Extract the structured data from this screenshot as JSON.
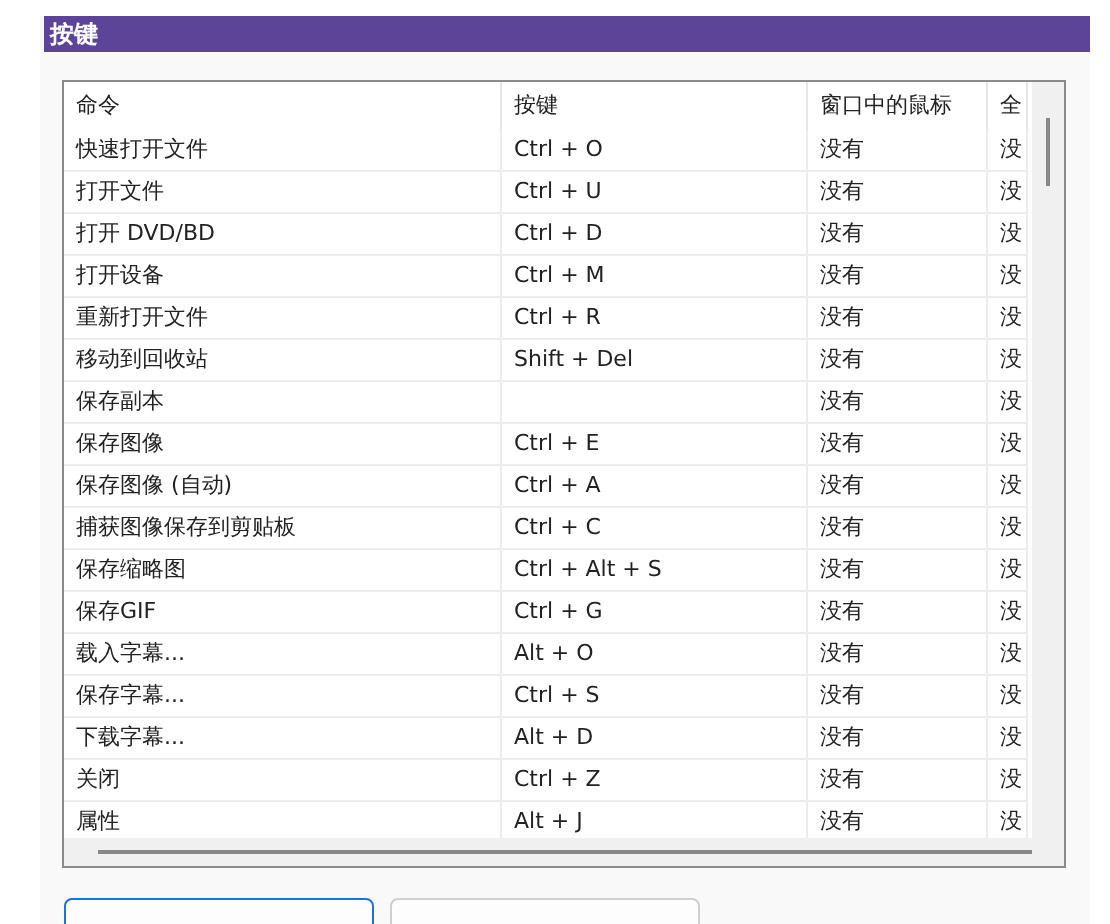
{
  "section": {
    "title": "按键"
  },
  "table": {
    "columns": [
      "命令",
      "按键",
      "窗口中的鼠标",
      "全"
    ],
    "rows": [
      [
        "快速打开文件",
        "Ctrl + O",
        "没有",
        "没"
      ],
      [
        "打开文件",
        "Ctrl + U",
        "没有",
        "没"
      ],
      [
        "打开 DVD/BD",
        "Ctrl + D",
        "没有",
        "没"
      ],
      [
        "打开设备",
        "Ctrl + M",
        "没有",
        "没"
      ],
      [
        "重新打开文件",
        "Ctrl + R",
        "没有",
        "没"
      ],
      [
        "移动到回收站",
        "Shift + Del",
        "没有",
        "没"
      ],
      [
        "保存副本",
        "",
        "没有",
        "没"
      ],
      [
        "保存图像",
        "Ctrl + E",
        "没有",
        "没"
      ],
      [
        "保存图像 (自动)",
        "Ctrl + A",
        "没有",
        "没"
      ],
      [
        "捕获图像保存到剪贴板",
        "Ctrl + C",
        "没有",
        "没"
      ],
      [
        "保存缩略图",
        "Ctrl + Alt + S",
        "没有",
        "没"
      ],
      [
        "保存GIF",
        "Ctrl + G",
        "没有",
        "没"
      ],
      [
        "载入字幕...",
        "Alt + O",
        "没有",
        "没"
      ],
      [
        "保存字幕...",
        "Ctrl + S",
        "没有",
        "没"
      ],
      [
        "下载字幕...",
        "Alt + D",
        "没有",
        "没"
      ],
      [
        "关闭",
        "Ctrl + Z",
        "没有",
        "没"
      ],
      [
        "属性",
        "Alt + J",
        "没有",
        "没"
      ]
    ]
  },
  "buttons": [
    {
      "selected": true
    },
    {
      "selected": false
    }
  ]
}
